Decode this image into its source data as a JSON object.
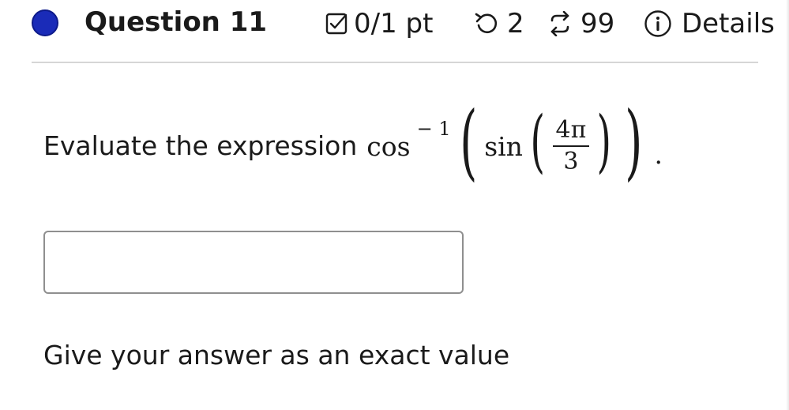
{
  "question": {
    "title": "Question 11",
    "status_color": "#1a2bb8",
    "points": "0/1 pt",
    "attempts": "2",
    "versions": "99",
    "details_label": "Details",
    "icons": {
      "status": "status-dot",
      "points": "checkbox-icon",
      "attempts": "retry-icon",
      "versions": "versions-icon",
      "details": "info-icon"
    }
  },
  "prompt": {
    "text": "Evaluate the expression",
    "math": {
      "outer_fn": "cos",
      "exponent": "− 1",
      "inner_fn": "sin",
      "numerator": "4π",
      "denominator": "3",
      "period": "."
    }
  },
  "answer": {
    "value": "",
    "placeholder": ""
  },
  "instruction": "Give your answer as an exact value"
}
